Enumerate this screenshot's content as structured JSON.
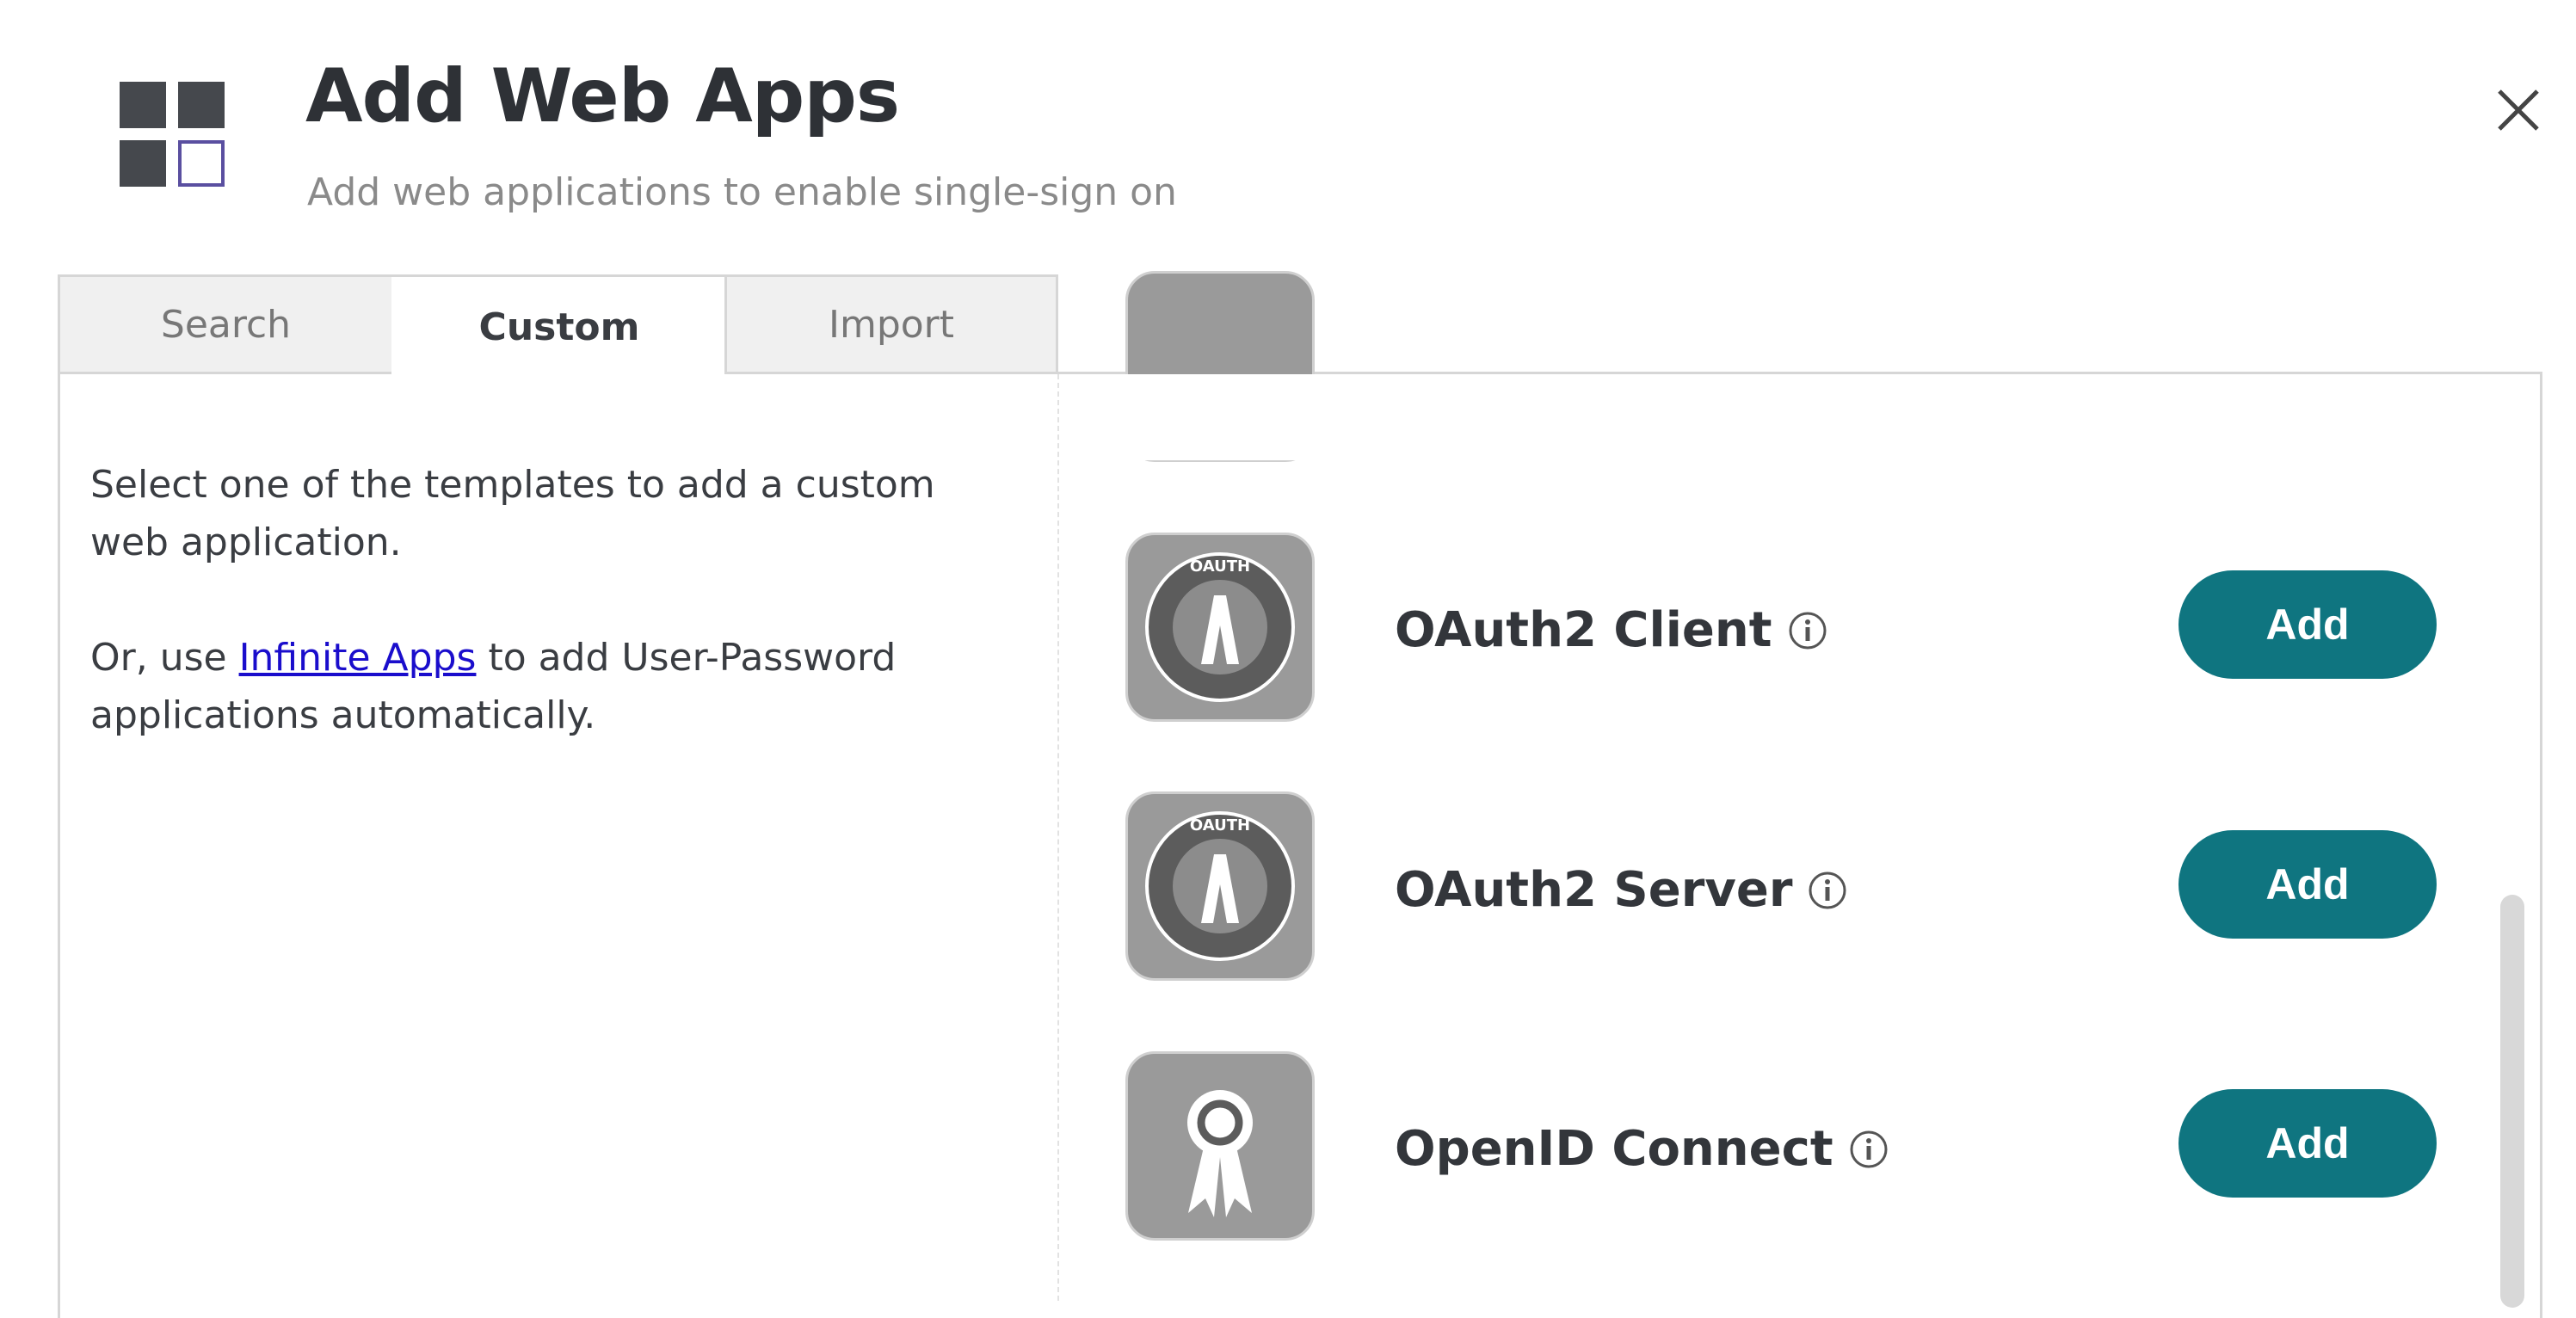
{
  "header": {
    "title": "Add Web Apps",
    "subtitle": "Add web applications to enable single-sign on",
    "icon": "apps-grid-icon",
    "close_icon": "close-icon"
  },
  "tabs": [
    {
      "label": "Search",
      "active": false
    },
    {
      "label": "Custom",
      "active": true
    },
    {
      "label": "Import",
      "active": false
    }
  ],
  "left": {
    "line1": "Select one of the templates to add a custom web application.",
    "line2_prefix": "Or, use ",
    "link": "Infinite Apps",
    "line2_suffix": " to add User-Password applications automatically."
  },
  "apps": [
    {
      "name": "OAuth2 Client",
      "icon": "oauth-icon",
      "button": "Add"
    },
    {
      "name": "OAuth2 Server",
      "icon": "oauth-icon",
      "button": "Add"
    },
    {
      "name": "OpenID Connect",
      "icon": "ribbon-award-icon",
      "button": "Add"
    }
  ],
  "colors": {
    "accent": "#0f7580",
    "icon_bg": "#9a9a9a",
    "link": "#1a0dcc"
  }
}
